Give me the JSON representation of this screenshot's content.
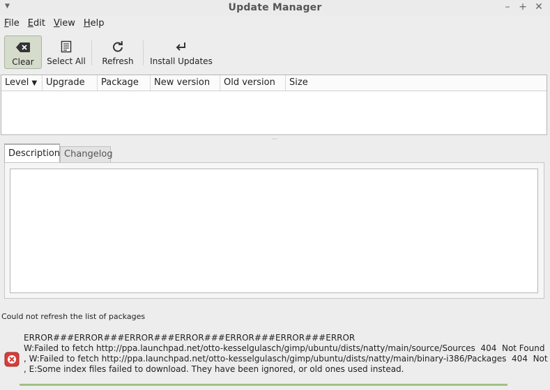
{
  "window": {
    "title": "Update Manager",
    "menu_glyph": "▼",
    "minimize": "–",
    "maximize": "+",
    "close": "✕"
  },
  "menubar": {
    "items": [
      {
        "label": "File",
        "accel": "F",
        "rest": "ile"
      },
      {
        "label": "Edit",
        "accel": "E",
        "rest": "dit"
      },
      {
        "label": "View",
        "accel": "V",
        "rest": "iew"
      },
      {
        "label": "Help",
        "accel": "H",
        "rest": "elp"
      }
    ]
  },
  "toolbar": {
    "clear": {
      "label": "Clear",
      "icon": "backspace-icon",
      "active": true
    },
    "select_all": {
      "label": "Select All",
      "icon": "document-list-icon"
    },
    "refresh": {
      "label": "Refresh",
      "icon": "refresh-icon"
    },
    "install": {
      "label": "Install Updates",
      "icon": "return-arrow-icon"
    }
  },
  "updates_table": {
    "columns": [
      "Level",
      "Upgrade",
      "Package",
      "New version",
      "Old version",
      "Size"
    ],
    "sort_glyph": "▼",
    "rows": []
  },
  "details": {
    "tabs": [
      "Description",
      "Changelog"
    ],
    "selected_tab": "Description",
    "description_text": ""
  },
  "status": {
    "text": "Could not refresh the list of packages"
  },
  "error": {
    "icon": "error-icon",
    "lines": [
      "ERROR###ERROR###ERROR###ERROR###ERROR###ERROR###ERROR",
      "W:Failed to fetch http://ppa.launchpad.net/otto-kesselgulasch/gimp/ubuntu/dists/natty/main/source/Sources  404  Not Found",
      ", W:Failed to fetch http://ppa.launchpad.net/otto-kesselgulasch/gimp/ubuntu/dists/natty/main/binary-i386/Packages  404  Not Found",
      ", E:Some index files failed to download. They have been ignored, or old ones used instead."
    ]
  },
  "colors": {
    "window_bg": "#ededed",
    "active_toolbar_bg": "#d5dccc",
    "progress": "#a2c084",
    "error_icon": "#d43f3a"
  }
}
